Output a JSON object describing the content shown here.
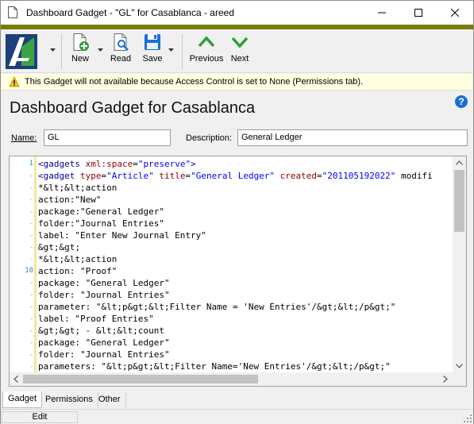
{
  "window": {
    "title": "Dashboard Gadget - \"GL\" for Casablanca - areed"
  },
  "toolbar": {
    "new_label": "New",
    "read_label": "Read",
    "save_label": "Save",
    "previous_label": "Previous",
    "next_label": "Next"
  },
  "warning": {
    "text": "This Gadget will not available because Access Control is set to None (Permissions tab)."
  },
  "page": {
    "heading": "Dashboard Gadget for Casablanca"
  },
  "form": {
    "name_label": "Name:",
    "name_value": "GL",
    "description_label": "Description:",
    "description_value": "General Ledger"
  },
  "editor": {
    "gutter_numbers": [
      "1",
      "",
      "",
      "",
      "",
      "",
      "",
      "",
      "",
      "10",
      "",
      "",
      "",
      "",
      "",
      "",
      "",
      ""
    ],
    "lines": [
      "<gadgets xml:space=\"preserve\">",
      "<gadget type=\"Article\" title=\"General Ledger\" created=\"201105192022\" modifi",
      "*&lt;&lt;action",
      "action:\"New\"",
      "package:\"General Ledger\"",
      "folder:\"Journal Entries\"",
      "label: \"Enter New Journal Entry\"",
      "&gt;&gt;",
      "*&lt;&lt;action",
      "action: \"Proof\"",
      "package: \"General Ledger\"",
      "folder: \"Journal Entries\"",
      "parameter: \"&lt;p&gt;&lt;Filter Name = 'New Entries'/&gt;&lt;/p&gt;\"",
      "label: \"Proof Entries\"",
      "&gt;&gt; - &lt;&lt;count",
      "package: \"General Ledger\"",
      "folder: \"Journal Entries\"",
      "parameters: \"&lt;p&gt;&lt;Filter Name='New Entries'/&gt;&lt;/p&gt;\""
    ]
  },
  "tabs": [
    {
      "label": "Gadget"
    },
    {
      "label": "Permissions"
    },
    {
      "label": "Other"
    }
  ],
  "status": {
    "mode": "Edit"
  },
  "colors": {
    "accent_bar": "#7b7a0a",
    "nav_green": "#2e9e3e",
    "warning_bg": "#ffffe1"
  }
}
